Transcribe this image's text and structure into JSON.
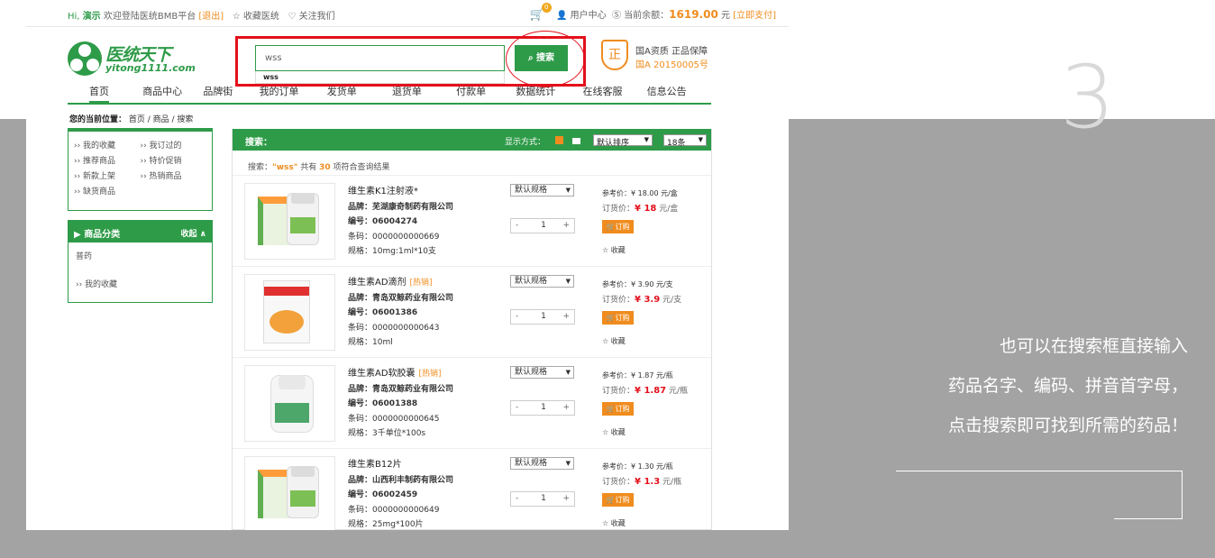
{
  "slide": {
    "number": "3",
    "caption": [
      "也可以在搜索框直接输入",
      "药品名字、编码、拼音首字母，",
      "点击搜索即可找到所需的药品！"
    ]
  },
  "topbar": {
    "greeting": "Hi,",
    "user": "演示",
    "welcome": " 欢迎登陆医统BMB平台",
    "logout": "[退出]",
    "favorite": "☆ 收藏医统",
    "follow": "♡ 关注我们",
    "cart_count": "0",
    "user_center": "用户中心",
    "balance_label": "当前余额：",
    "balance_value": "1619.00",
    "balance_unit": "元",
    "pay_link": "[立即支付]"
  },
  "logo": {
    "name_cn": "医统天下",
    "name_en": "yitong1111.com"
  },
  "search": {
    "value": "wss",
    "button": "⌕ 搜索",
    "suggestion": "wss"
  },
  "cert": {
    "line1": "国A资质 正品保障",
    "line2": "国A 20150005号",
    "icon": "正"
  },
  "nav": [
    "首页",
    "商品中心",
    "品牌街",
    "我的订单",
    "发货单",
    "退货单",
    "付款单",
    "数据统计",
    "在线客服",
    "信息公告"
  ],
  "breadcrumb": {
    "label": "您的当前位置：",
    "path": "首页 / 商品 / 搜索"
  },
  "sidebar": {
    "links": [
      "›› 我的收藏",
      "›› 我订过的",
      "›› 推荐商品",
      "›› 特价促销",
      "›› 新款上架",
      "›› 热销商品",
      "›› 缺货商品"
    ],
    "category_title": "商品分类",
    "collapse": "收起 ∧",
    "category_items": [
      "普药",
      "›› 我的收藏"
    ]
  },
  "results": {
    "title": "搜索：",
    "display_label": "显示方式：",
    "sort": "默认排序",
    "page_size": "18条",
    "summary_prefix": "搜索：",
    "summary_kw": "\"wss\"",
    "summary_mid": " 共有 ",
    "summary_count": "30",
    "summary_suffix": " 项符合查询结果",
    "products": [
      {
        "name": "维生素K1注射液*",
        "tag": "",
        "brand_label": "品牌：",
        "brand": "芜湖康奇制药有限公司",
        "code_label": "编号：",
        "code": "06004274",
        "barcode_label": "条码：",
        "barcode": "0000000000669",
        "spec_label": "规格：",
        "spec": "10mg:1ml*10支",
        "spec_select": "默认规格",
        "qty": "1",
        "ref_price": "参考价：¥ 18.00 元/盒",
        "order_label": "订货价：",
        "order_price": "¥ 18",
        "order_unit": " 元/盒",
        "buy": "订购",
        "fav": "☆ 收藏"
      },
      {
        "name": "维生素AD滴剂",
        "tag": "[热销]",
        "brand_label": "品牌：",
        "brand": "青岛双鲸药业有限公司",
        "code_label": "编号：",
        "code": "06001386",
        "barcode_label": "条码：",
        "barcode": "0000000000643",
        "spec_label": "规格：",
        "spec": "10ml",
        "spec_select": "默认规格",
        "qty": "1",
        "ref_price": "参考价：¥ 3.90 元/支",
        "order_label": "订货价：",
        "order_price": "¥ 3.9",
        "order_unit": " 元/支",
        "buy": "订购",
        "fav": "☆ 收藏"
      },
      {
        "name": "维生素AD软胶囊",
        "tag": "[热销]",
        "brand_label": "品牌：",
        "brand": "青岛双鲸药业有限公司",
        "code_label": "编号：",
        "code": "06001388",
        "barcode_label": "条码：",
        "barcode": "0000000000645",
        "spec_label": "规格：",
        "spec": "3千单位*100s",
        "spec_select": "默认规格",
        "qty": "1",
        "ref_price": "参考价：¥ 1.87 元/瓶",
        "order_label": "订货价：",
        "order_price": "¥ 1.87",
        "order_unit": " 元/瓶",
        "buy": "订购",
        "fav": "☆ 收藏"
      },
      {
        "name": "维生素B12片",
        "tag": "",
        "brand_label": "品牌：",
        "brand": "山西利丰制药有限公司",
        "code_label": "编号：",
        "code": "06002459",
        "barcode_label": "条码：",
        "barcode": "0000000000649",
        "spec_label": "规格：",
        "spec": "25mg*100片",
        "spec_select": "默认规格",
        "qty": "1",
        "ref_price": "参考价：¥ 1.30 元/瓶",
        "order_label": "订货价：",
        "order_price": "¥ 1.3",
        "order_unit": " 元/瓶",
        "buy": "订购",
        "fav": "☆ 收藏"
      }
    ]
  }
}
